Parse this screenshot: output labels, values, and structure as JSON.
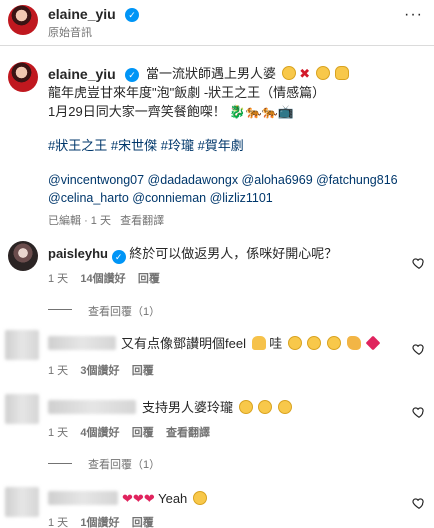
{
  "header": {
    "username": "elaine_yiu",
    "subtitle": "原始音訊",
    "more": "···"
  },
  "caption": {
    "username": "elaine_yiu",
    "line1_text": "當一流狀師遇上男人婆",
    "line2": "龍年虎豈甘來年度\"泡\"飯劇 -狀王之王（情感篇）",
    "line3": "1月29日同大家一齊笑餐飽㗎！",
    "hashtags": [
      "#狀王之王",
      "#宋世傑",
      "#玲瓏",
      "#賀年劇"
    ],
    "mentions_line1": "@vincentwong07 @dadadawongx @aloha6969 @fatchung816",
    "mentions_line2": "@celina_harto @connieman @lizliz1101",
    "meta": {
      "edited": "已編輯",
      "time": "1 天",
      "translate": "查看翻譯"
    }
  },
  "comments": [
    {
      "username": "paisleyhu",
      "text": "終於可以做返男人，係咪好開心呢？",
      "time": "1 天",
      "likes": "14個讚好",
      "reply": "回覆",
      "view_replies": "查看回覆（1）"
    },
    {
      "text": "又有点像鄧讃明個feel",
      "tail": "哇",
      "time": "1 天",
      "likes": "3個讚好",
      "reply": "回覆"
    },
    {
      "text": "支持男人婆玲瓏",
      "time": "1 天",
      "likes": "4個讚好",
      "reply": "回覆",
      "translate": "查看翻譯",
      "view_replies": "查看回覆（1）"
    },
    {
      "text": "Yeah",
      "time": "1 天",
      "likes": "1個讚好",
      "reply": "回覆"
    }
  ],
  "meta_separator": "·",
  "colors": {
    "verified": "#0095f6",
    "secondary_text": "#737373",
    "hashtag": "#00376b"
  }
}
